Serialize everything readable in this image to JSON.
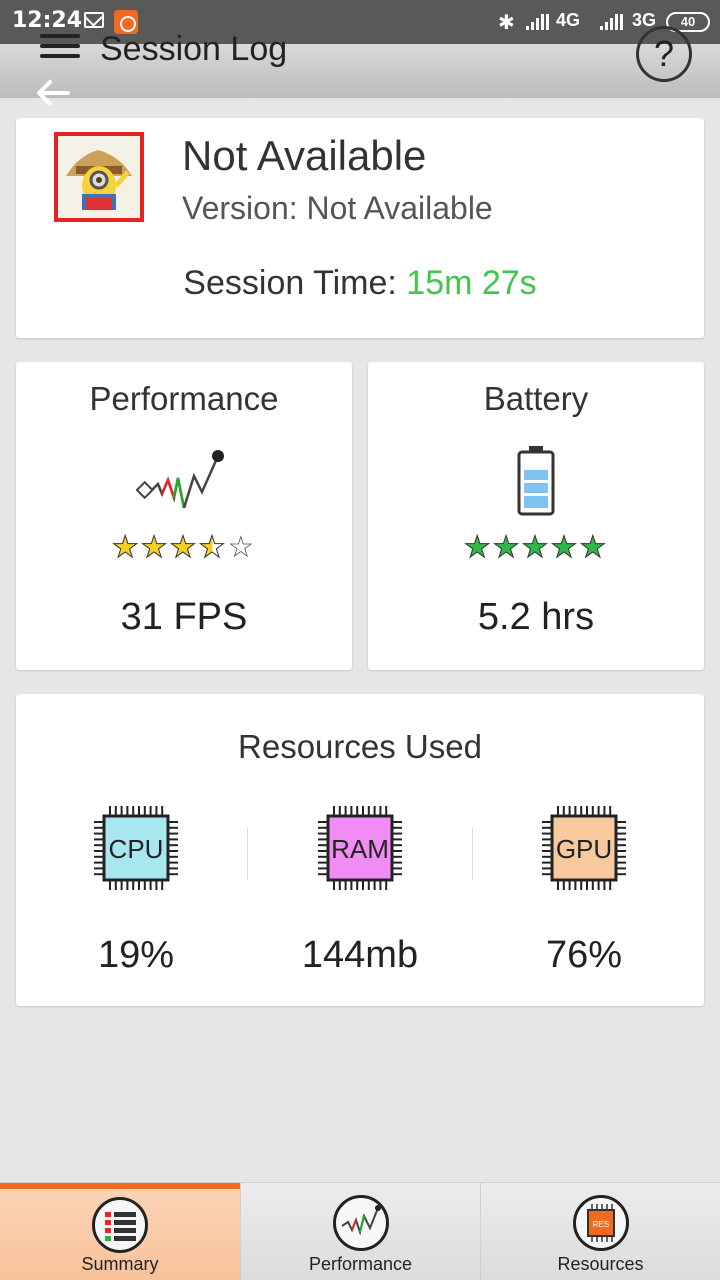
{
  "status_bar": {
    "time": "12:24",
    "network_1": "4G",
    "network_2": "3G",
    "battery": "40"
  },
  "app_bar": {
    "title": "Session Log",
    "help_label": "?"
  },
  "app_info": {
    "name": "Not Available",
    "version": "Version: Not Available",
    "session_label": "Session Time:",
    "session_value": "15m 27s"
  },
  "performance": {
    "title": "Performance",
    "rating": 3.5,
    "rating_max": 5,
    "value": "31 FPS"
  },
  "battery_card": {
    "title": "Battery",
    "rating": 5,
    "rating_max": 5,
    "value": "5.2 hrs"
  },
  "resources": {
    "title": "Resources Used",
    "items": [
      {
        "chip_label": "CPU",
        "value": "19%",
        "color": "#a8e6f0"
      },
      {
        "chip_label": "RAM",
        "value": "144mb",
        "color": "#f08cf4"
      },
      {
        "chip_label": "GPU",
        "value": "76%",
        "color": "#f8c99e"
      }
    ]
  },
  "bottom_nav": {
    "tabs": [
      {
        "label": "Summary",
        "active": true
      },
      {
        "label": "Performance",
        "active": false
      },
      {
        "label": "Resources",
        "active": false
      }
    ],
    "resources_icon_text": "RES"
  },
  "colors": {
    "accent": "#f26a22",
    "session_value": "#3fc64c",
    "star_yellow": "#f2d024",
    "star_green": "#2fb84a"
  }
}
